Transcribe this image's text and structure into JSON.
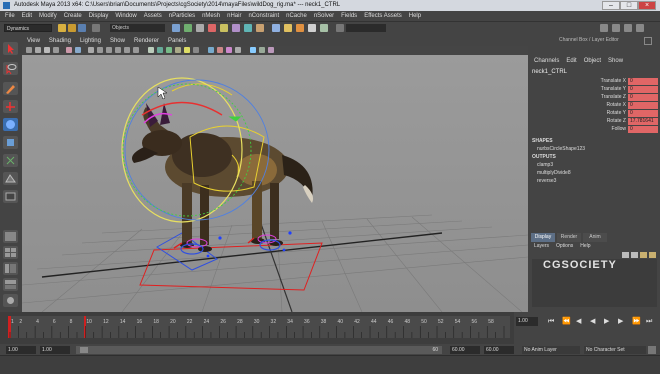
{
  "window": {
    "title": "Autodesk Maya 2013 x64: C:\\Users\\brian\\Documents\\Projects\\cgSociety\\2014\\mayaFiles\\wildDog_rig.ma*  ---  neck1_CTRL"
  },
  "menubar": [
    "File",
    "Edit",
    "Modify",
    "Create",
    "Display",
    "Window",
    "Assets",
    "nParticles",
    "nMesh",
    "nHair",
    "nConstraint",
    "nCache",
    "nSolver",
    "Fields",
    "Effects Assets",
    "Help"
  ],
  "statusline": {
    "menu_set": "Dynamics",
    "selection_mode": "Objects"
  },
  "panel_menu": [
    "View",
    "Shading",
    "Lighting",
    "Show",
    "Renderer",
    "Panels"
  ],
  "channel_box": {
    "title": "Channel Box / Layer Editor",
    "menu": [
      "Channels",
      "Edit",
      "Object",
      "Show"
    ],
    "object_name": "neck1_CTRL",
    "attributes": [
      {
        "label": "Translate X",
        "value": "0"
      },
      {
        "label": "Translate Y",
        "value": "0"
      },
      {
        "label": "Translate Z",
        "value": "0"
      },
      {
        "label": "Rotate X",
        "value": "0"
      },
      {
        "label": "Rotate Y",
        "value": "0"
      },
      {
        "label": "Rotate Z",
        "value": "17.781641"
      },
      {
        "label": "Follow",
        "value": "0"
      }
    ],
    "shapes_header": "SHAPES",
    "shapes": [
      "nurbsCircleShape123"
    ],
    "outputs_header": "OUTPUTS",
    "outputs": [
      "clamp3",
      "multiplyDivide8",
      "reverse3"
    ]
  },
  "layer_editor": {
    "tabs": [
      "Display",
      "Render",
      "Anim"
    ],
    "menu": [
      "Layers",
      "Options",
      "Help"
    ]
  },
  "time_slider": {
    "ticks": [
      "1",
      "2",
      "4",
      "6",
      "8",
      "10",
      "12",
      "14",
      "16",
      "18",
      "20",
      "22",
      "24",
      "26",
      "28",
      "30",
      "32",
      "34",
      "36",
      "38",
      "40",
      "42",
      "44",
      "46",
      "48",
      "50",
      "52",
      "54",
      "56",
      "58"
    ],
    "current_frame": "1.00"
  },
  "range_slider": {
    "start_time": "1.00",
    "playback_start": "1.00",
    "range_label": "60",
    "playback_end": "60.00",
    "end_time": "60.00",
    "anim_layer": "No Anim Layer",
    "character_set": "No Character Set"
  },
  "watermark": "CGSOCIETY",
  "colors": {
    "keyed_attr": "#e06666",
    "accent_blue": "#2a6eb5",
    "frame_marker": "#d02020"
  }
}
